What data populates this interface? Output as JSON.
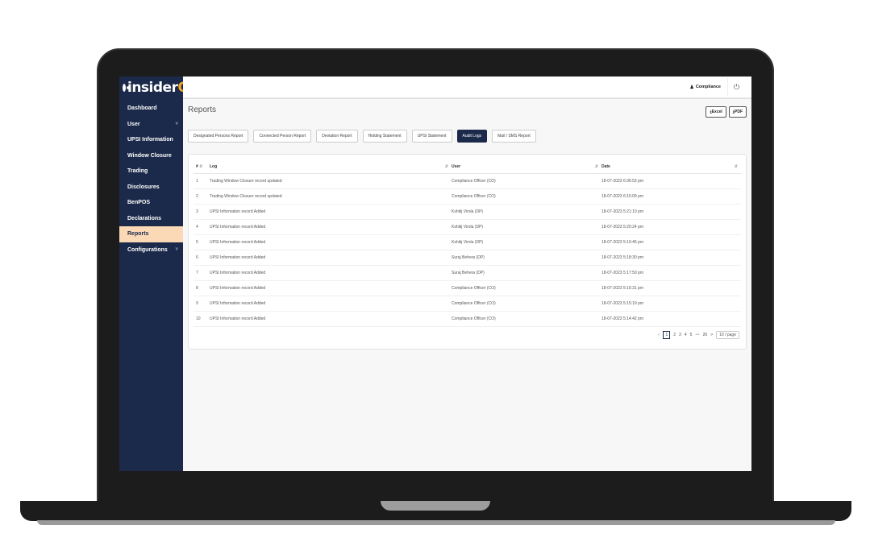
{
  "brand": {
    "name": "insider",
    "accent_letter": "Q"
  },
  "sidebar": {
    "items": [
      {
        "label": "Dashboard",
        "expand": false
      },
      {
        "label": "User",
        "expand": true
      },
      {
        "label": "UPSI Information",
        "expand": false
      },
      {
        "label": "Window Closure",
        "expand": false
      },
      {
        "label": "Trading",
        "expand": false
      },
      {
        "label": "Disclosures",
        "expand": false
      },
      {
        "label": "BenPOS",
        "expand": false
      },
      {
        "label": "Declarations",
        "expand": false
      },
      {
        "label": "Reports",
        "expand": false,
        "active": true
      },
      {
        "label": "Configurations",
        "expand": true
      }
    ]
  },
  "header": {
    "user_label": "Compliance",
    "user_icon": "person-icon",
    "logout_icon": "power-icon"
  },
  "page": {
    "title": "Reports",
    "export_excel": "Excel",
    "export_pdf": "PDF"
  },
  "tabs": [
    "Designated Persons Report",
    "Connected Person Report",
    "Deviation Report",
    "Holding Statement",
    "UPSI Statement",
    "Audit Logs",
    "Mail / SMS Report"
  ],
  "active_tab": "Audit Logs",
  "table": {
    "columns": [
      "#",
      "Log",
      "User",
      "Date"
    ],
    "rows": [
      [
        "1",
        "Trading Window Closure record updated",
        "Compliance Officer (CO)",
        "18-07-2023 6:36:53 pm"
      ],
      [
        "2",
        "Trading Window Closure record updated",
        "Compliance Officer (CO)",
        "18-07-2023 6:15:09 pm"
      ],
      [
        "3",
        "UPSI Information record Added",
        "Kshitij Virola (DP)",
        "18-07-2023 5:21:10 pm"
      ],
      [
        "4",
        "UPSI Information record Added",
        "Kshitij Virola (DP)",
        "18-07-2023 5:20:24 pm"
      ],
      [
        "5",
        "UPSI Information record Added",
        "Kshitij Virola (DP)",
        "18-07-2023 5:19:46 pm"
      ],
      [
        "6",
        "UPSI Information record Added",
        "Suraj Behera (DP)",
        "18-07-2023 5:18:30 pm"
      ],
      [
        "7",
        "UPSI Information record Added",
        "Suraj Behera (DP)",
        "18-07-2023 5:17:50 pm"
      ],
      [
        "8",
        "UPSI Information record Added",
        "Compliance Officer (CO)",
        "18-07-2023 5:16:31 pm"
      ],
      [
        "9",
        "UPSI Information record Added",
        "Compliance Officer (CO)",
        "18-07-2023 5:15:19 pm"
      ],
      [
        "10",
        "UPSI Information record Added",
        "Compliance Officer (CO)",
        "18-07-2023 5:14:42 pm"
      ]
    ]
  },
  "pagination": {
    "prev": "<",
    "pages": [
      "1",
      "2",
      "3",
      "4",
      "5"
    ],
    "current": "1",
    "ellipsis": "•••",
    "last": "26",
    "next": ">",
    "page_size": "10 / page"
  },
  "colors": {
    "sidebar_bg": "#1b2a4a",
    "active_nav_bg": "#fbd9b6",
    "accent": "#f5a623"
  }
}
